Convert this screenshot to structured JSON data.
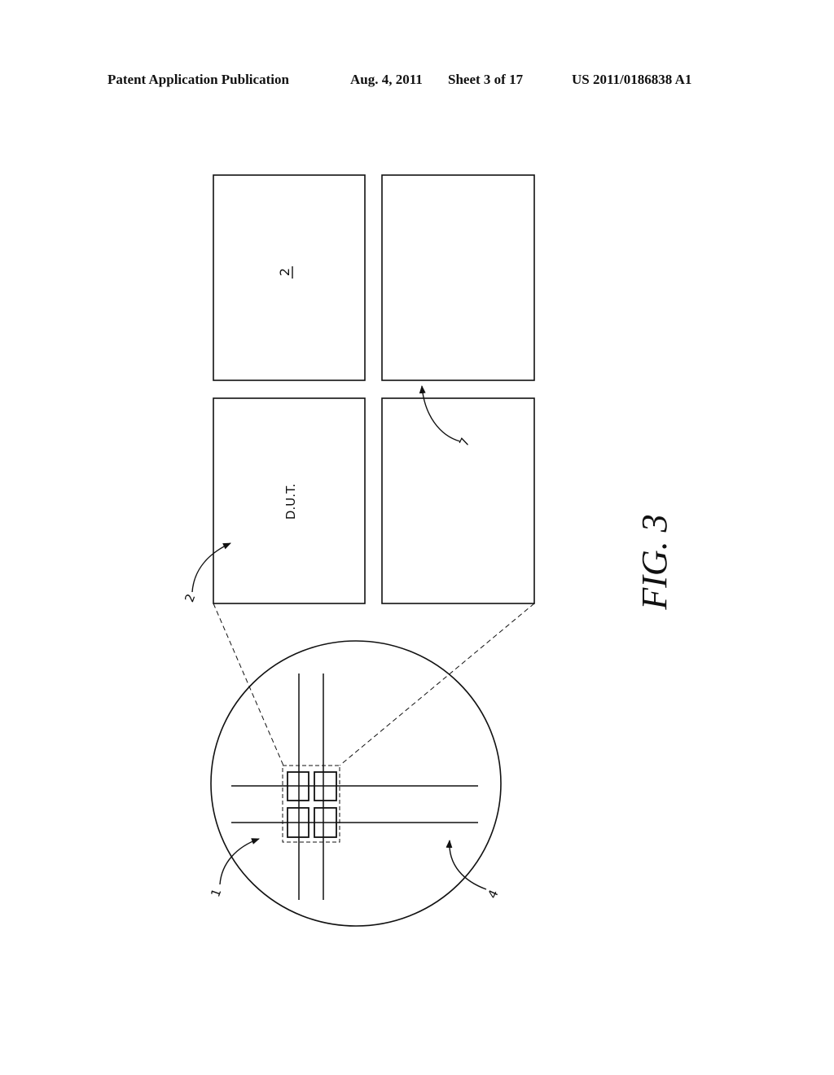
{
  "header": {
    "publication": "Patent Application Publication",
    "date": "Aug. 4, 2011",
    "sheet": "Sheet 3 of 17",
    "number": "US 2011/0186838 A1"
  },
  "figure": {
    "caption": "FIG. 3",
    "die_label": "D.U.T.",
    "die_ref_underlined": "2",
    "ref_labels": {
      "wafer_area": "1",
      "die": "2",
      "wafer": "4",
      "scribe_gap": "7"
    }
  },
  "colors": {
    "ink": "#111111",
    "background": "#ffffff"
  }
}
